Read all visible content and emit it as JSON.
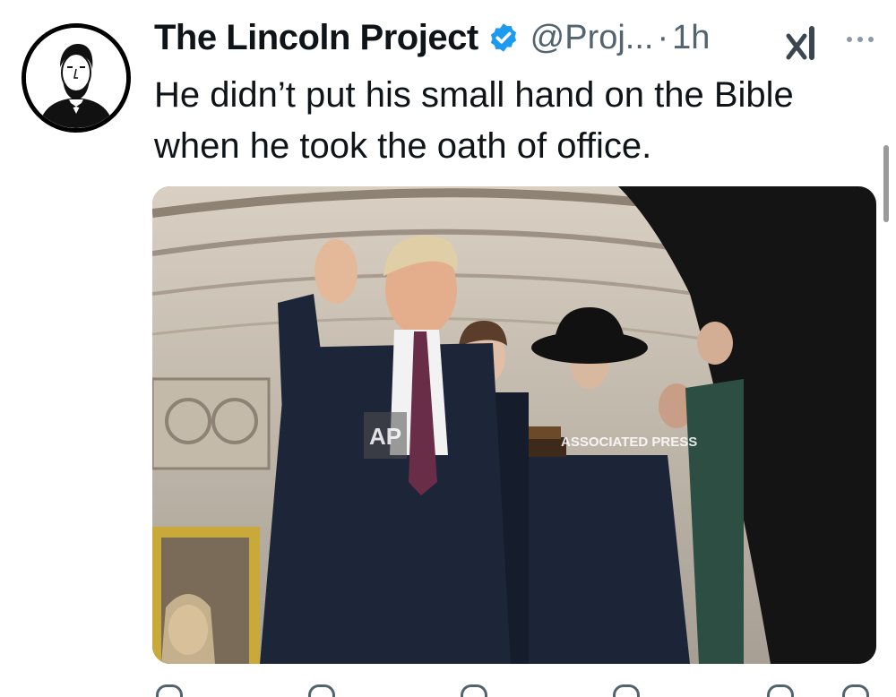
{
  "tweet": {
    "author_name": "The Lincoln Project",
    "handle": "@Proj...",
    "separator": "·",
    "time": "1h",
    "text": "He didn’t put his small hand on the Bible when he took the oath of office.",
    "verified": true
  },
  "media": {
    "watermark_logo": "AP",
    "watermark_text": "ASSOCIATED PRESS"
  },
  "icons": [
    "lincoln-avatar",
    "verified-badge-icon",
    "grok-icon",
    "more-icon",
    "reply-icon",
    "repost-icon",
    "like-icon",
    "views-icon",
    "bookmark-icon",
    "share-icon"
  ],
  "colors": {
    "text": "#0f1419",
    "muted": "#536471",
    "verified": "#1d9bf0"
  }
}
